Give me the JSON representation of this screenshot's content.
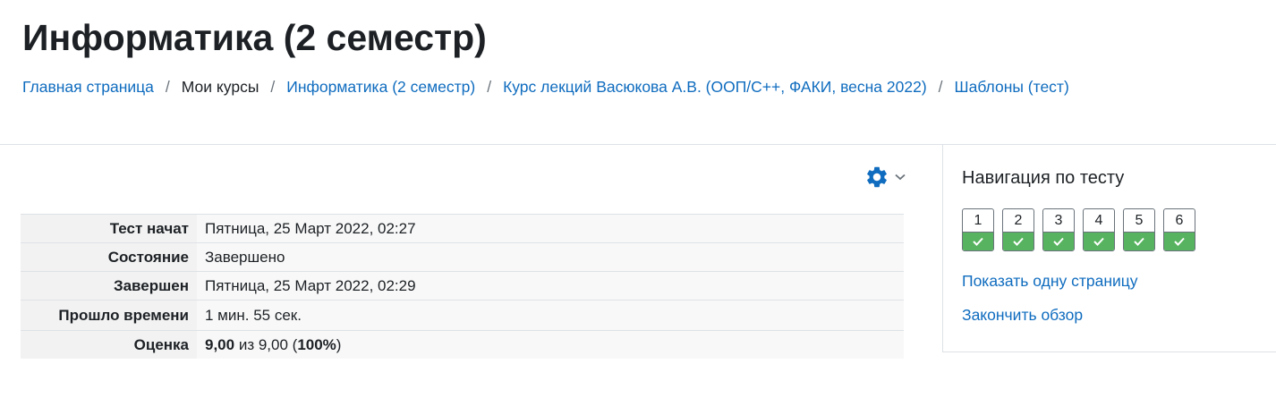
{
  "header": {
    "title": "Информатика (2 семестр)"
  },
  "breadcrumb": [
    {
      "label": "Главная страница"
    },
    {
      "label": "Мои курсы"
    },
    {
      "label": "Информатика (2 семестр)"
    },
    {
      "label": "Курс лекций Васюкова А.В. (ООП/C++, ФАКИ, весна 2022)"
    },
    {
      "label": "Шаблоны (тест)"
    }
  ],
  "breadcrumb_separator": "/",
  "icons": {
    "settings": "gear-icon",
    "menu_caret": "chevron-down-icon",
    "question_answered": "check-icon"
  },
  "summary": {
    "rows": [
      {
        "label": "Тест начат",
        "value": "Пятница, 25 Март 2022, 02:27"
      },
      {
        "label": "Состояние",
        "value": "Завершено"
      },
      {
        "label": "Завершен",
        "value": "Пятница, 25 Март 2022, 02:29"
      },
      {
        "label": "Прошло времени",
        "value": "1 мин. 55 сек."
      }
    ],
    "grade": {
      "label": "Оценка",
      "score": "9,00",
      "of_text": " из 9,00 (",
      "percent": "100%",
      "close": ")"
    }
  },
  "quiz_nav": {
    "title": "Навигация по тесту",
    "questions": [
      "1",
      "2",
      "3",
      "4",
      "5",
      "6"
    ],
    "show_one_page": "Показать одну страницу",
    "finish_review": "Закончить обзор"
  },
  "colors": {
    "link": "#0f6cbf",
    "answered": "#57b35f",
    "gear": "#0f6cbf"
  }
}
